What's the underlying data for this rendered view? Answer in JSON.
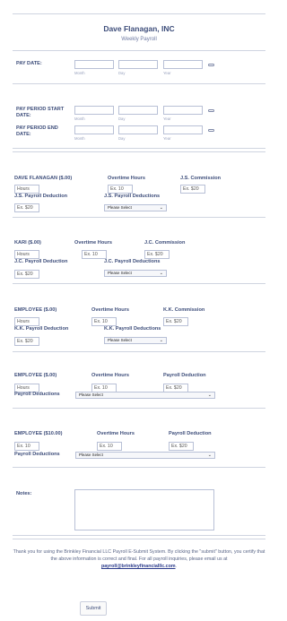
{
  "header": {
    "company": "Dave Flanagan, INC",
    "subtitle": "Weekly Payroll"
  },
  "pay_date": {
    "label": "PAY DATE:",
    "month": "Month",
    "day": "Day",
    "year": "Year"
  },
  "pay_period_start": {
    "label": "PAY PERIOD START DATE:",
    "month": "Month",
    "day": "Day",
    "year": "Year"
  },
  "pay_period_end": {
    "label": "PAY PERIOD END DATE:",
    "month": "Month",
    "day": "Day",
    "year": "Year"
  },
  "employees": [
    {
      "name_label": "DAVE FLANAGAN ($.00)",
      "hours_placeholder": "Hours",
      "overtime_label": "Overtime Hours",
      "overtime_placeholder": "Ex. 10",
      "commission_label": "J.S. Commission",
      "commission_placeholder": "Ex. $20",
      "payroll_label": "J.S. Payroll Deduction",
      "payroll_placeholder": "Ex. $20",
      "deductions_label": "J.S. Payroll Deductions",
      "deductions_value": "Please Select"
    },
    {
      "name_label": "KARI ($.00)",
      "hours_placeholder": "Hours",
      "overtime_label": "Overtime Hours",
      "overtime_placeholder": "Ex. 10",
      "commission_label": "J.C. Commission",
      "commission_placeholder": "Ex. $20",
      "payroll_label": "J.C. Payroll Deduction",
      "payroll_placeholder": "Ex. $20",
      "deductions_label": "J.C. Payroll Deductions",
      "deductions_value": "Please Select"
    },
    {
      "name_label": "EMPLOYEE ($.00)",
      "hours_placeholder": "Hours",
      "overtime_label": "Overtime Hours",
      "overtime_placeholder": "Ex. 10",
      "commission_label": "K.K. Commission",
      "commission_placeholder": "Ex. $20",
      "payroll_label": "K.K. Payroll Deduction",
      "payroll_placeholder": "Ex. $20",
      "deductions_label": "K.K. Payroll Deductions",
      "deductions_value": "Please Select"
    },
    {
      "name_label": "EMPLOYEE ($.00)",
      "hours_placeholder": "Hours",
      "overtime_label": "Overtime Hours",
      "overtime_placeholder": "Ex. 10",
      "payroll_label": "Payroll Deduction",
      "payroll_placeholder": "Ex. $20",
      "deductions_label": "Payroll Deductions",
      "deductions_value": "Please Select"
    },
    {
      "name_label": "EMPLOYEE ($10.00)",
      "hours_placeholder": "Ex. 10",
      "overtime_label": "Overtime Hours",
      "overtime_placeholder": "Ex. 10",
      "payroll_label": "Payroll Deduction",
      "payroll_placeholder": "Ex. $20",
      "deductions_label": "Payroll Deductions",
      "deductions_value": "Please Select"
    }
  ],
  "notes": {
    "label": "Notes:"
  },
  "footer": {
    "thanks_text": "Thank you for using the Brinkley Financial LLC Payroll E-Submit System. By clicking the \"submit\" button, you certify that the above information is correct and final. For all payroll inquiries, please email us at",
    "email": "payroll@brinkleyfinancialllc.com",
    "period": "."
  },
  "submit_label": "Submit",
  "colors": {
    "label": "#3d4d7a",
    "border": "#b8c0d6",
    "link": "#2a3a8a"
  }
}
